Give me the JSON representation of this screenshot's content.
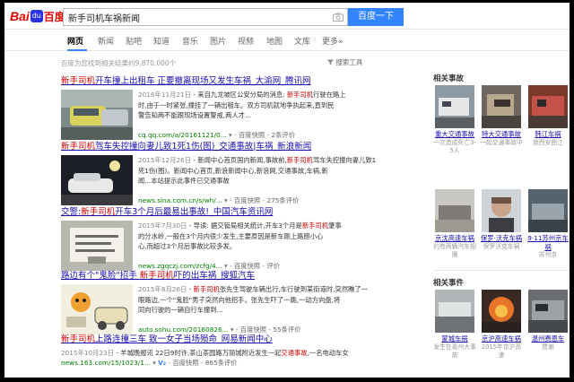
{
  "header": {
    "logo_text_1": "Bai",
    "logo_paw": "du",
    "logo_text_2": "百度",
    "query": "新手司机车祸新闻",
    "search_button": "百度一下"
  },
  "nav": {
    "tabs": [
      "网页",
      "新闻",
      "贴吧",
      "知道",
      "音乐",
      "图片",
      "视频",
      "地图",
      "文库",
      "更多»"
    ]
  },
  "result_count": "百度为您找到相关结果约9,870,000个",
  "search_tools": "搜索工具",
  "results": [
    {
      "title_pre": "新手司机",
      "title_post": "开车撞上出租车 正要撤离现场又发生车祸_大渝网_腾讯网",
      "date": "2016年11月21日",
      "line1_a": " - 来自九龙坡区公安分局的消息: ",
      "line1_em": "新手司机",
      "line1_b": "行驶在路上",
      "line2": "时,由于一时紧张,撞挂了一辆出租车。双方司机就地争执起来,直到民",
      "line3": "警告知两不能跟现场设置警戒,两人才...",
      "url": "cq.qq.com/a/20161121/0...",
      "snapshot": "百度快照",
      "reviews": "2条评价"
    },
    {
      "title_pre": "新手司机",
      "title_post": "驾车失控撞向妻儿致1死1伤(图)_交通事故|车祸_新浪新闻",
      "date": "2015年12月26日",
      "line1_a": " - 新闻中心首页国内新闻,事故前,",
      "line1_em": "新手司机",
      "line1_b": "驾车失控撞向妻儿致1",
      "line2": "死1伤(图)。新闻中心首页,新浪新闻中心,新浪网,交通事故,车祸,新",
      "line3": "闻...本站提示此事件已交通事故",
      "url": "news.sina.com.cn/s/wh/...",
      "snapshot": "百度快照",
      "reviews": "275条评价"
    },
    {
      "title_pre": "交警:",
      "title_mid": "新手司机",
      "title_post": "开车3个月后最易出事故!_中国汽车资讯网",
      "date": "2015年7月30日",
      "line1_a": " - 导读: 据交管局相关统计,开车3个月是",
      "line1_em": "新手司机",
      "line1_b": "肇事",
      "line2": "的分水岭,一般在3个月内很少发生,主要原因是新车刚上路胆小心",
      "line3": "心,而超过3个月后事故比较多发。",
      "url": "news.zgqczj.com/zcfg/4...",
      "snapshot": "百度快照",
      "reviews": "评价"
    },
    {
      "title_pre": "路边有个\"鬼脸\"招手 ",
      "title_mid": "新手司机",
      "title_post": "吓的出车祸_搜狐汽车",
      "date": "2015年8月26日",
      "line1_a": " - ",
      "line1_em": "新手司机",
      "line1_b": "张先生驾驶车辆出行,车行驶到某街道时,突然瞧了一",
      "line2": "眼路边,一个\"鬼脸\"男子突然向他招手。张先生吓了一跳,一动方向盘,将",
      "line3": "同向行驶的一辆自行车撞到...",
      "url": "auto.sohu.com/20160826...",
      "snapshot": "百度快照",
      "reviews": "55条评价"
    },
    {
      "title_pre": "新手司机",
      "title_post": "上路连撞三车 致一女子当场殒命_网易新闻中心",
      "date": "2015年10月23日",
      "line1_a": " - 羊城晚报讯 22日9时许,茶山茶园路万丽城附近发生一起",
      "line1_em": "交通事故",
      "line1_b": ",一名电动",
      "line2": "车女",
      "url": "news.163.com/15/1023/1...",
      "snapshot": "百度快照",
      "reviews": "865条评价"
    }
  ],
  "related_events_1": {
    "title": "相关事故",
    "items": [
      {
        "name": "重大交通事故",
        "desc": "一次造成死亡3-5人"
      },
      {
        "name": "特大交通事故",
        "desc": "一起交通事故中"
      },
      {
        "name": "韩江车祸",
        "desc": "旅西安曲江"
      },
      {
        "name": "京沈高速车祸",
        "desc": "约有两辆汽车相撞"
      },
      {
        "name": "保罗·沃克车祸",
        "desc": "保罗沃克车祸"
      },
      {
        "name": "9·11苏州京车祸",
        "desc": "苏州京"
      }
    ]
  },
  "related_events_2": {
    "title": "相关事件",
    "items": [
      {
        "name": "蒙城车祸",
        "desc": "发生在亳州大事故"
      },
      {
        "name": "京沪高速车祸",
        "desc": "2015年京沪高速"
      },
      {
        "name": "温州费恩车",
        "desc": "费谢"
      }
    ]
  }
}
